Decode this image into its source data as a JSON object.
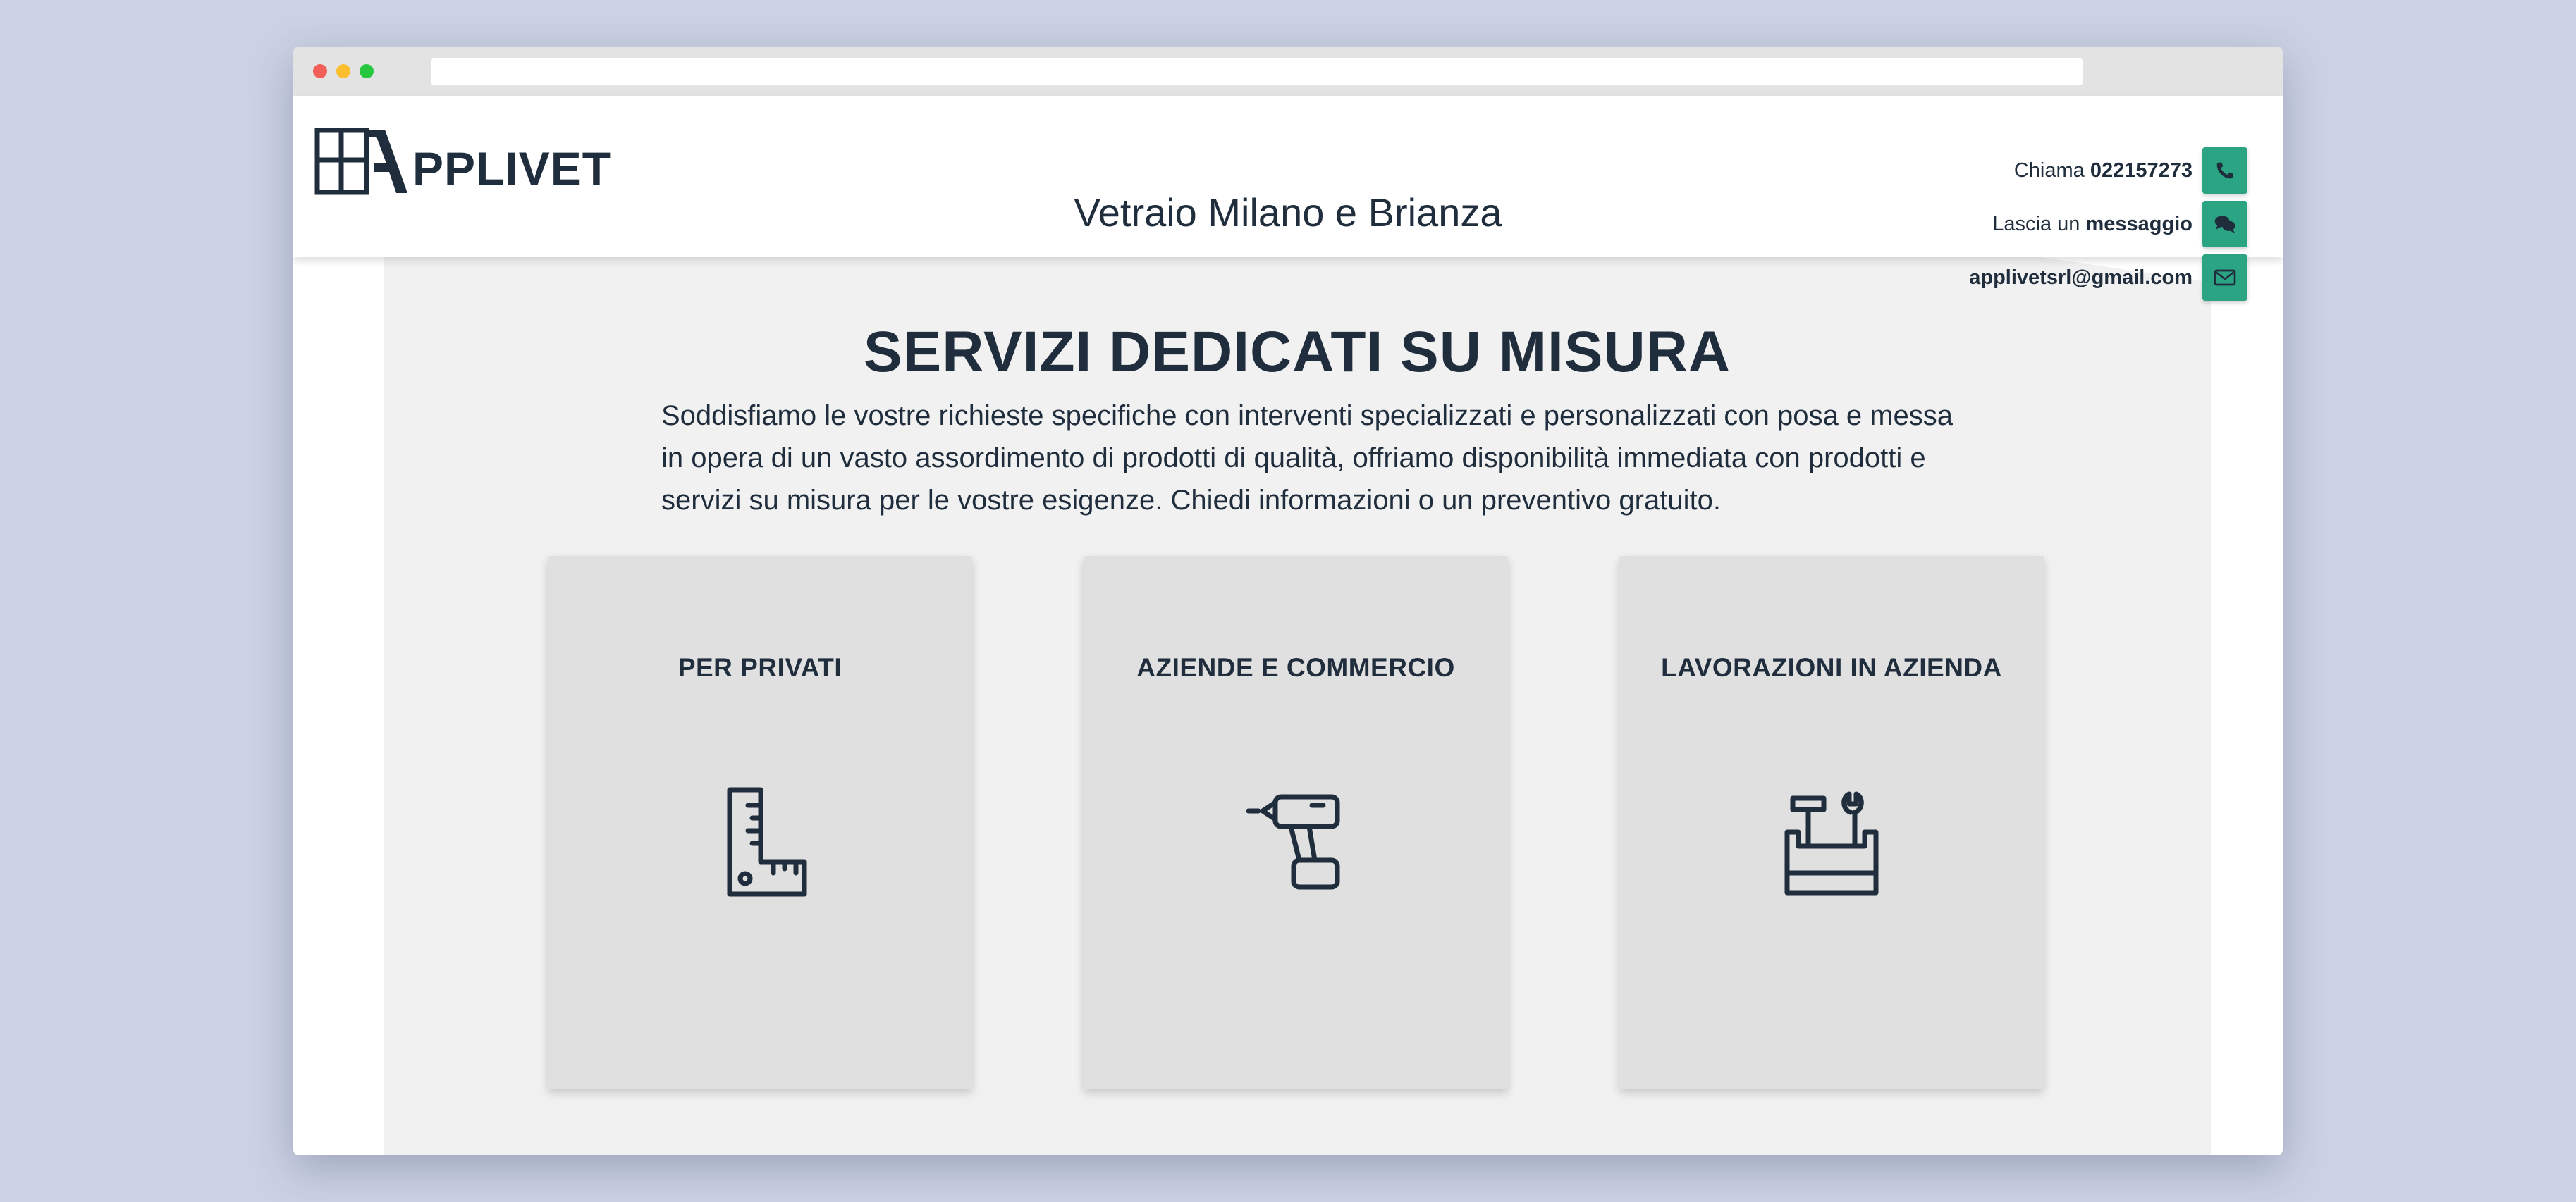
{
  "browser": {
    "url": ""
  },
  "header": {
    "logo_text": "PPLIVET",
    "title": "Vetraio Milano e Brianza",
    "contacts": {
      "phone_prefix": "Chiama",
      "phone_number": "022157273",
      "message_prefix": "Lascia un",
      "message_text": "messaggio",
      "email": "applivetsrl@gmail.com"
    },
    "accent_color": "#2aa483"
  },
  "main": {
    "title": "SERVIZI DEDICATI SU MISURA",
    "intro": "Soddisfiamo le vostre richieste specifiche con interventi specializzati e personalizzati con posa e messa in opera di un vasto assordimento di prodotti di qualità, offriamo disponibilità immediata con prodotti e servizi su misura per le vostre esigenze. Chiedi informazioni o un preventivo gratuito.",
    "cards": [
      {
        "title": "PER PRIVATI",
        "icon": "ruler-square-icon"
      },
      {
        "title": "AZIENDE E COMMERCIO",
        "icon": "drill-icon"
      },
      {
        "title": "LAVORAZIONI IN AZIENDA",
        "icon": "toolbox-icon"
      }
    ]
  }
}
